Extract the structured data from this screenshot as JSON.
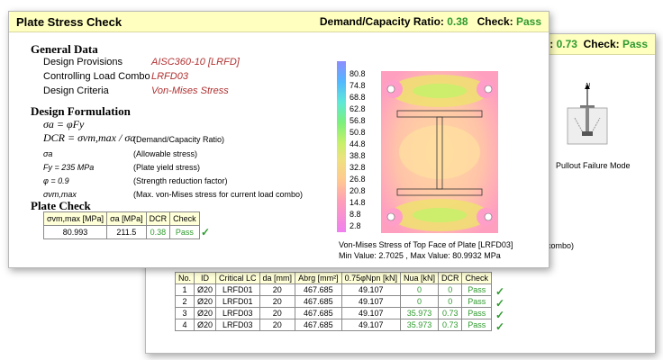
{
  "back": {
    "ratio_label": "o: ",
    "ratio_value": "0.73",
    "check_label": "Check:",
    "check_value": "Pass",
    "caption": "Pullout Failure Mode",
    "side_text": "combo)",
    "force_label": "N",
    "table": {
      "headers": [
        "No.",
        "ID",
        "Critical LC",
        "da [mm]",
        "Abrg [mm²]",
        "0.75φNpn [kN]",
        "Nua [kN]",
        "DCR",
        "Check"
      ],
      "rows": [
        [
          "1",
          "Ø20",
          "LRFD01",
          "20",
          "467.685",
          "49.107",
          "0",
          "0",
          "Pass"
        ],
        [
          "2",
          "Ø20",
          "LRFD01",
          "20",
          "467.685",
          "49.107",
          "0",
          "0",
          "Pass"
        ],
        [
          "3",
          "Ø20",
          "LRFD03",
          "20",
          "467.685",
          "49.107",
          "35.973",
          "0.73",
          "Pass"
        ],
        [
          "4",
          "Ø20",
          "LRFD03",
          "20",
          "467.685",
          "49.107",
          "35.973",
          "0.73",
          "Pass"
        ]
      ]
    }
  },
  "front": {
    "title": "Plate Stress Check",
    "ratio_label": "Demand/Capacity Ratio:",
    "ratio_value": "0.38",
    "check_label": "Check:",
    "check_value": "Pass",
    "general": {
      "heading": "General Data",
      "rows": [
        {
          "label": "Design Provisions",
          "value": "AISC360-10 [LRFD]"
        },
        {
          "label": "Controlling Load Combo",
          "value": "LRFD03"
        },
        {
          "label": "Design Criteria",
          "value": "Von-Mises Stress"
        }
      ]
    },
    "formulation": {
      "heading": "Design Formulation",
      "eq1": "σa = φFy",
      "eq2": "DCR = σvm,max / σa",
      "eq2_note": "(Demand/Capacity Ratio)",
      "items": [
        {
          "sym": "σa",
          "desc": "(Allowable stress)"
        },
        {
          "sym": "Fy = 235 MPa",
          "desc": "(Plate yield stress)"
        },
        {
          "sym": "φ = 0.9",
          "desc": "(Strength reduction factor)"
        },
        {
          "sym": "σvm,max",
          "desc": "(Max. von-Mises stress for current load combo)"
        }
      ]
    },
    "plate_check": {
      "heading": "Plate Check",
      "headers": [
        "σvm,max [MPa]",
        "σa  [MPa]",
        "DCR",
        "Check"
      ],
      "row": [
        "80.993",
        "211.5",
        "0.38",
        "Pass"
      ]
    },
    "legend": [
      "80.8",
      "74.8",
      "68.8",
      "62.8",
      "56.8",
      "50.8",
      "44.8",
      "38.8",
      "32.8",
      "26.8",
      "20.8",
      "14.8",
      "8.8",
      "2.8"
    ],
    "plot_caption_1": "Von-Mises Stress of Top Face of Plate [LRFD03]",
    "plot_caption_2": "Min Value: 2.7025 , Max Value: 80.9932 MPa"
  },
  "colors": {
    "title_bg": "#ffffc0",
    "pass_green": "#2e9a2e",
    "value_red": "#b03030"
  }
}
